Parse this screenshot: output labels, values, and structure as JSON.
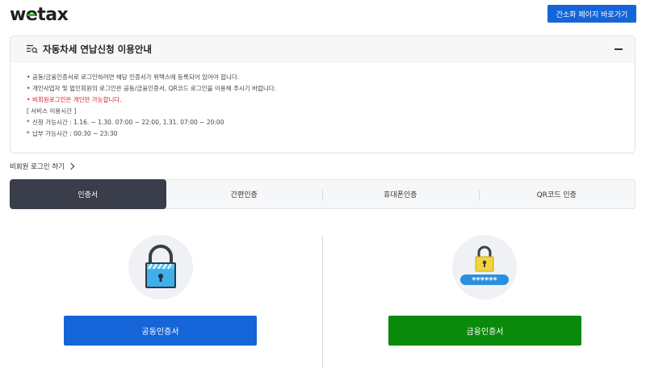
{
  "header": {
    "logo": "wetax",
    "simple_page_button": "간소화 페이지 바로가기"
  },
  "notice": {
    "title": "자동차세 연납신청 이용안내",
    "lines": [
      "공동/금융인증서로 로그인하려면 해당 인증서가 위택스에 등록되어 있어야 합니다.",
      "개인사업자 및 법인회원의 로그인은 공동/금융인증서, QR코드 로그인을 이용해 주시기 바랍니다.",
      "비회원로그인은 개인만 가능합니다.",
      "[ 서비스 이용시간 ]",
      "신청 가능시간 : 1.16. ~ 1.30. 07:00 ~ 22:00,    1.31. 07:00 ~ 20:00",
      "납부 가능시간 : 00:30 ~ 23:30"
    ]
  },
  "nonmember_login": "비회원 로그인 하기",
  "tabs": [
    "인증서",
    "간편인증",
    "휴대폰인증",
    "QR코드 인증"
  ],
  "buttons": {
    "joint_cert": "공동인증서",
    "financial_cert": "금융인증서"
  },
  "colors": {
    "primary_blue": "#1565d8",
    "green": "#0a8a0a",
    "active_tab": "#3a3d4a",
    "warning_red": "#d81b2c"
  },
  "icons": {
    "left": "padlock-certificate-icon",
    "right": "padlock-password-icon"
  }
}
